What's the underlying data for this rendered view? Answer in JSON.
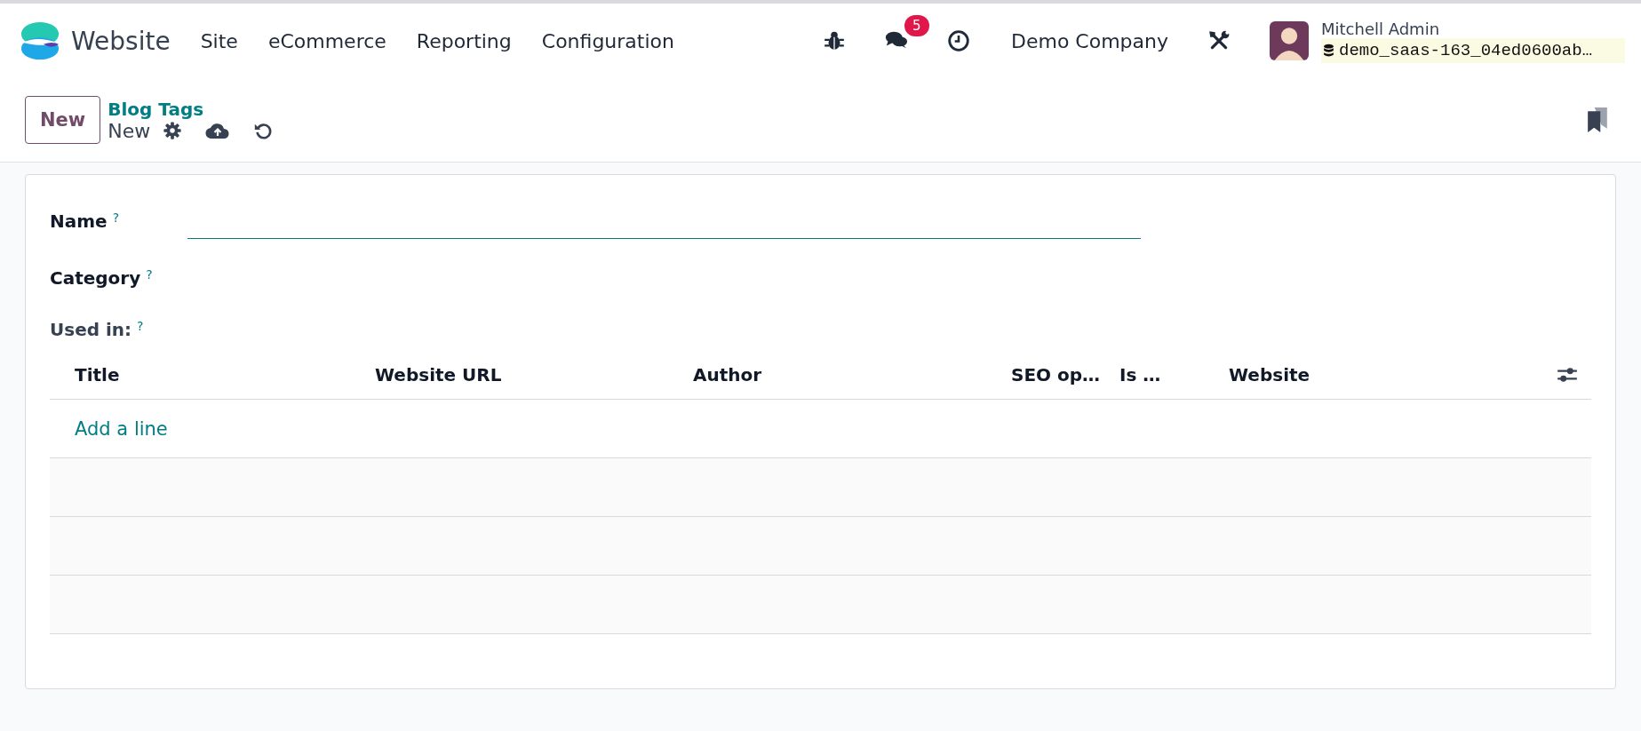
{
  "navbar": {
    "app_name": "Website",
    "menu": [
      "Site",
      "eCommerce",
      "Reporting",
      "Configuration"
    ],
    "systray": {
      "message_count": "5",
      "company": "Demo Company",
      "user_name": "Mitchell Admin",
      "database": "demo_saas-163_04ed0600ab…"
    }
  },
  "control_panel": {
    "new_button": "New",
    "breadcrumb": "Blog Tags",
    "current": "New"
  },
  "form": {
    "fields": [
      {
        "label": "Name",
        "help": "?",
        "kind": "input"
      },
      {
        "label": "Category",
        "help": "?",
        "kind": "plain"
      }
    ],
    "used_in": {
      "label": "Used in:",
      "help": "?"
    },
    "table": {
      "columns": [
        "Title",
        "Website URL",
        "Author",
        "SEO op…",
        "Is …",
        "Website"
      ],
      "add_line": "Add a line"
    }
  }
}
